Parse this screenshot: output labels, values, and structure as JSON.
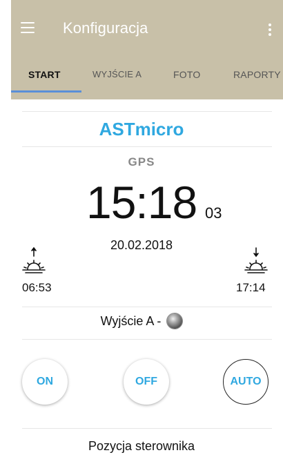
{
  "appbar": {
    "title": "Konfiguracja",
    "menu_icon": "hamburger-menu-icon",
    "more_icon": "more-vertical-icon",
    "background": "#c8c0a8"
  },
  "tabs": [
    {
      "label": "START",
      "active": true
    },
    {
      "label": "WYJŚCIE A",
      "active": false
    },
    {
      "label": "FOTO",
      "active": false
    },
    {
      "label": "RAPORTY",
      "active": false
    }
  ],
  "device": {
    "name": "ASTmicro",
    "sync_source": "GPS",
    "time": "15:18",
    "seconds": "03",
    "date": "20.02.2018",
    "sunrise": "06:53",
    "sunset": "17:14",
    "sunrise_icon": "sunrise-icon",
    "sunset_icon": "sunset-icon"
  },
  "output": {
    "label": "Wyjście A -",
    "indicator_icon": "status-led-icon"
  },
  "modes": {
    "on": "ON",
    "off": "OFF",
    "auto": "AUTO",
    "selected": "AUTO"
  },
  "section": {
    "position_label": "Pozycja sterownika"
  },
  "colors": {
    "accent": "#2fa8e0",
    "tab_indicator": "#5a8fd8"
  }
}
